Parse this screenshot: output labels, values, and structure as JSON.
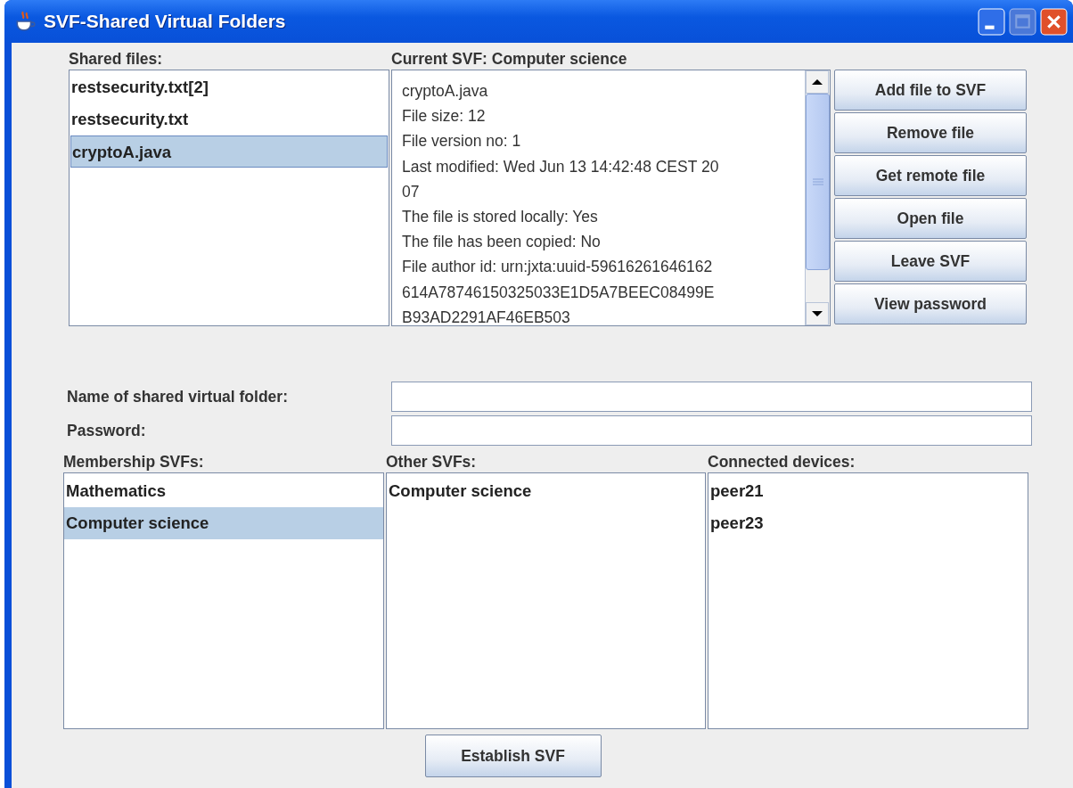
{
  "window": {
    "title": "SVF-Shared Virtual Folders"
  },
  "shared_files": {
    "label": "Shared files:",
    "items": [
      {
        "name": "restsecurity.txt[2]",
        "selected": false
      },
      {
        "name": "restsecurity.txt",
        "selected": false
      },
      {
        "name": "cryptoA.java",
        "selected": true
      }
    ]
  },
  "current_svf": {
    "label": "Current SVF: Computer science",
    "lines": [
      "cryptoA.java",
      "File size: 12",
      "File version no: 1",
      "Last modified: Wed Jun 13 14:42:48 CEST 20",
      "07",
      "The file is stored locally: Yes",
      "The file has been copied: No",
      "File author id: urn:jxta:uuid-59616261646162",
      "614A78746150325033E1D5A7BEEC08499E",
      "B93AD2291AF46EB503"
    ]
  },
  "buttons": [
    "Add file to SVF",
    "Remove file",
    "Get remote file",
    "Open file",
    "Leave SVF",
    "View password"
  ],
  "form": [
    {
      "label": "Name of shared virtual folder:"
    },
    {
      "label": "Password:"
    }
  ],
  "lists": [
    {
      "label": "Membership SVFs:",
      "items": [
        {
          "name": "Mathematics",
          "selected": false
        },
        {
          "name": "Computer science",
          "selected": true
        }
      ]
    },
    {
      "label": "Other SVFs:",
      "items": [
        {
          "name": "Computer science",
          "selected": false
        }
      ]
    },
    {
      "label": "Connected devices:",
      "items": [
        {
          "name": "peer21",
          "selected": false
        },
        {
          "name": "peer23",
          "selected": false
        }
      ]
    }
  ],
  "establish_button": "Establish SVF"
}
